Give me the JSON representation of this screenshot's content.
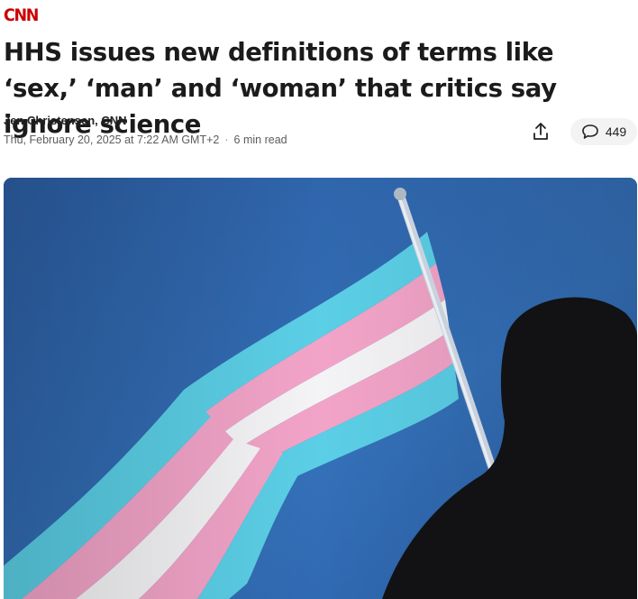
{
  "brand": {
    "logo_text": "CNN",
    "color": "#cc0000"
  },
  "article": {
    "headline": "HHS issues new definitions of terms like ‘sex,’ ‘man’ and ‘woman’ that critics say ignore science",
    "author": "Jen Christensen, CNN",
    "date": "Thu, February 20, 2025 at 7:22 AM GMT+2",
    "separator": "·",
    "read_time": "6 min read"
  },
  "actions": {
    "share_icon": "share-icon",
    "comment_icon": "comment-bubble-icon",
    "comment_count": "449"
  },
  "hero_image": {
    "subject": "transgender-pride-flag",
    "colors": {
      "sky": "#2e63a8",
      "blue": "#5bcfe6",
      "pink": "#f2a4c8",
      "white": "#f4f4f6",
      "pole": "#c9d2dc",
      "silhouette": "#121214"
    }
  }
}
